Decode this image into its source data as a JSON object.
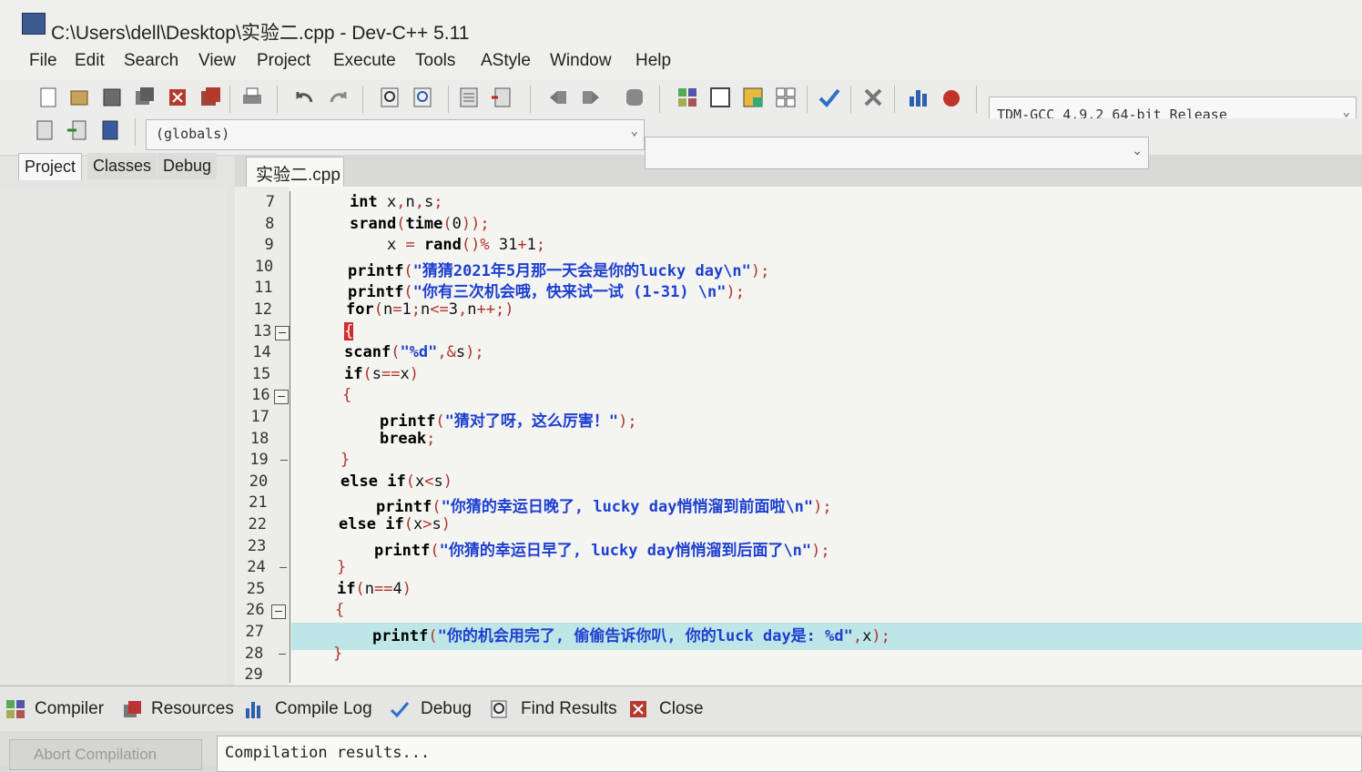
{
  "window": {
    "title": "C:\\Users\\dell\\Desktop\\实验二.cpp - Dev-C++ 5.11"
  },
  "menu": [
    "File",
    "Edit",
    "Search",
    "View",
    "Project",
    "Execute",
    "Tools",
    "AStyle",
    "Window",
    "Help"
  ],
  "toolbar": {
    "compiler": "TDM-GCC 4.9.2 64-bit Release",
    "scope": "(globals)"
  },
  "left_panel": {
    "tabs": [
      "Project",
      "Classes",
      "Debug"
    ]
  },
  "editor": {
    "tab": "实验二.cpp",
    "lines": [
      {
        "n": "7",
        "code": "int x,n,s;"
      },
      {
        "n": "8",
        "code": "srand(time(0));"
      },
      {
        "n": "9",
        "code": "    x = rand()% 31+1;"
      },
      {
        "n": "10",
        "code": "printf(\"猜猜2021年5月那一天会是你的lucky day\\n\");"
      },
      {
        "n": "11",
        "code": "printf(\"你有三次机会哦，快来试一试 (1-31) \\n\");"
      },
      {
        "n": "12",
        "code": "for(n=1;n<=3,n++;)"
      },
      {
        "n": "13",
        "code": "{"
      },
      {
        "n": "14",
        "code": "scanf(\"%d\",&s);"
      },
      {
        "n": "15",
        "code": "if(s==x)"
      },
      {
        "n": "16",
        "code": "{"
      },
      {
        "n": "17",
        "code": "    printf(\"猜对了呀，这么厉害！\");"
      },
      {
        "n": "18",
        "code": "    break;"
      },
      {
        "n": "19",
        "code": "}"
      },
      {
        "n": "20",
        "code": "else if(x<s)"
      },
      {
        "n": "21",
        "code": "    printf(\"你猜的幸运日晚了, lucky day悄悄溜到前面啦\\n\");"
      },
      {
        "n": "22",
        "code": "else if(x>s)"
      },
      {
        "n": "23",
        "code": "    printf(\"你猜的幸运日早了, lucky day悄悄溜到后面了\\n\");"
      },
      {
        "n": "24",
        "code": "}"
      },
      {
        "n": "25",
        "code": "if(n==4)"
      },
      {
        "n": "26",
        "code": "{"
      },
      {
        "n": "27",
        "code": "    printf(\"你的机会用完了, 偷偷告诉你叭, 你的luck day是: %d\",x);"
      },
      {
        "n": "28",
        "code": "}"
      },
      {
        "n": "29",
        "code": ""
      }
    ]
  },
  "bottom": {
    "tabs": [
      "Compiler",
      "Resources",
      "Compile Log",
      "Debug",
      "Find Results",
      "Close"
    ],
    "abort": "Abort Compilation",
    "output": "Compilation results..."
  },
  "colors": {
    "string": "#1d3fd0",
    "current_line": "#bfe6e6",
    "bracket_highlight": "#d12b2b"
  }
}
